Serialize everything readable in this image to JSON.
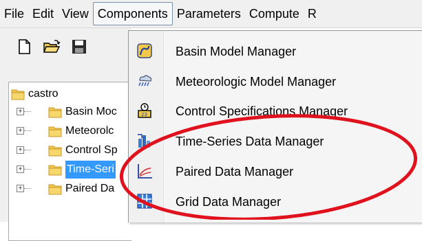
{
  "menubar": {
    "items": [
      "File",
      "Edit",
      "View",
      "Components",
      "Parameters",
      "Compute",
      "R"
    ]
  },
  "toolbar": {
    "buttons": [
      "new-file-icon",
      "open-folder-icon",
      "save-disk-icon"
    ]
  },
  "tree": {
    "root": "castro",
    "children": [
      "Basin Moc",
      "Meteorolc",
      "Control Sp",
      "Time-Seri",
      "Paired Da"
    ],
    "selected_index": 3
  },
  "components_menu": {
    "items": [
      {
        "label": "Basin Model Manager",
        "icon": "basin-model-icon"
      },
      {
        "label": "Meteorologic Model Manager",
        "icon": "meteorologic-icon"
      },
      {
        "label": "Control Specifications Manager",
        "icon": "control-spec-icon"
      },
      {
        "label": "Time-Series Data Manager",
        "icon": "time-series-icon"
      },
      {
        "label": "Paired Data Manager",
        "icon": "paired-data-icon"
      },
      {
        "label": "Grid Data Manager",
        "icon": "grid-data-icon"
      }
    ]
  },
  "colors": {
    "highlight_circle": "#e0121e",
    "selection": "#3399ff",
    "folder": "#f2c94c"
  }
}
